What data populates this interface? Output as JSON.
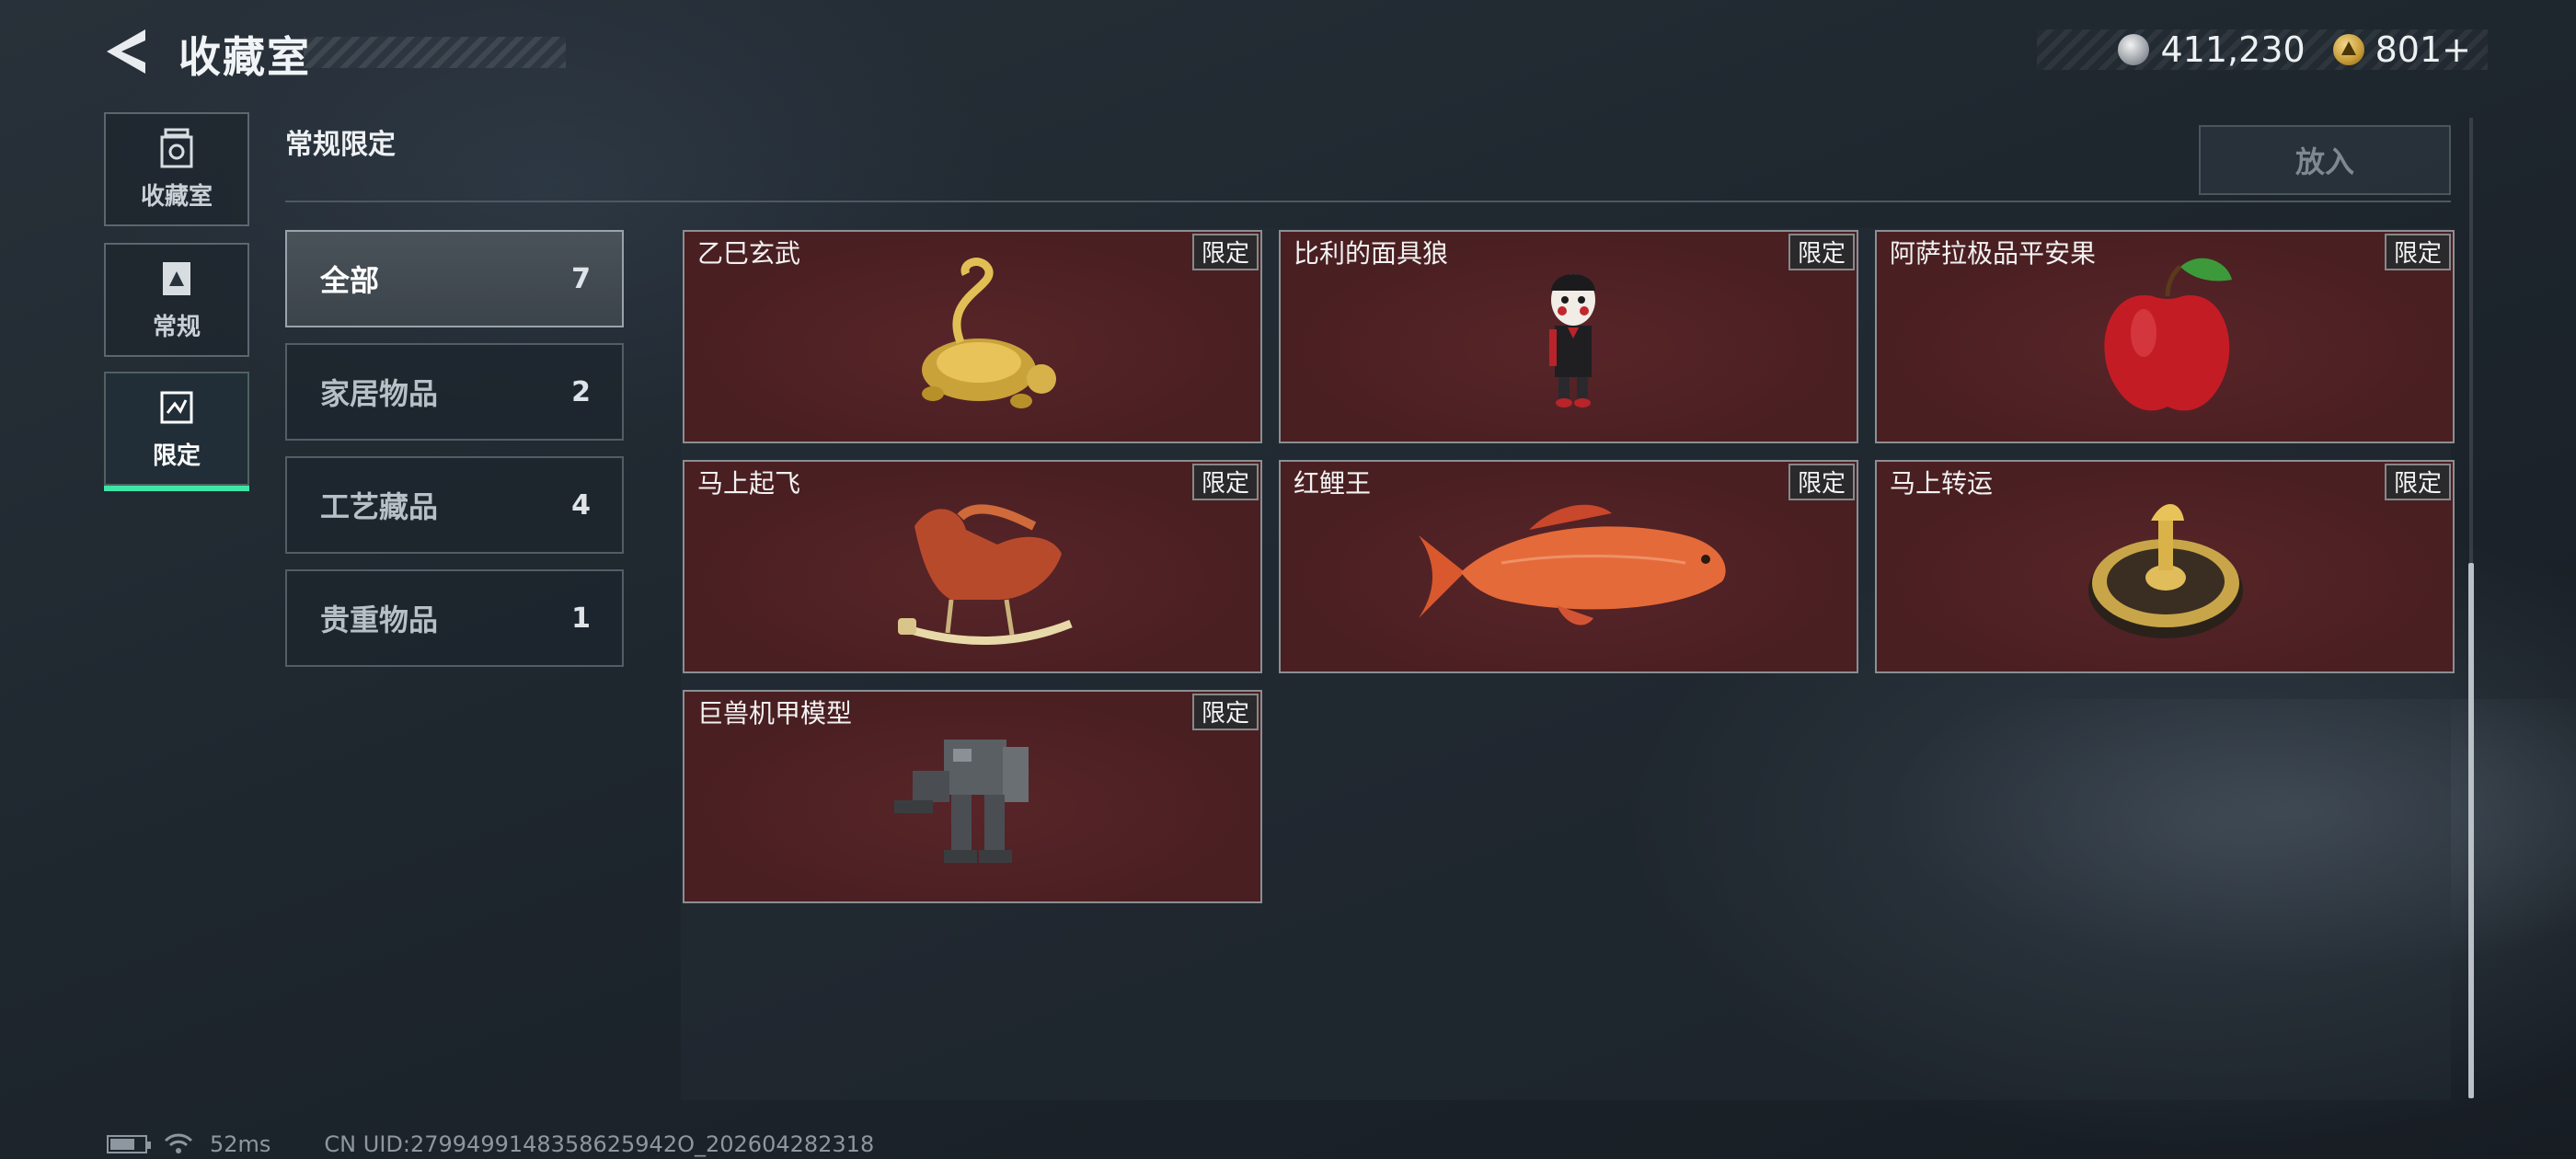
{
  "header": {
    "title": "收藏室",
    "currencies": [
      {
        "icon": "silver-coin-icon",
        "value": "411,230"
      },
      {
        "icon": "gold-triangle-coin-icon",
        "value": "801+"
      }
    ]
  },
  "rail": [
    {
      "label": "收藏室",
      "icon": "collection-room-icon",
      "active": false
    },
    {
      "label": "常规",
      "icon": "regular-icon",
      "active": false
    },
    {
      "label": "限定",
      "icon": "limited-icon",
      "active": true
    }
  ],
  "section": {
    "title": "常规限定",
    "put_button": "放入"
  },
  "categories": [
    {
      "name": "全部",
      "count": "7",
      "active": true
    },
    {
      "name": "家居物品",
      "count": "2",
      "active": false
    },
    {
      "name": "工艺藏品",
      "count": "4",
      "active": false
    },
    {
      "name": "贵重物品",
      "count": "1",
      "active": false
    }
  ],
  "items": [
    {
      "name": "乙巳玄武",
      "badge": "限定",
      "art": "golden-turtle-snake"
    },
    {
      "name": "比利的面具狼",
      "badge": "限定",
      "art": "puppet-figure"
    },
    {
      "name": "阿萨拉极品平安果",
      "badge": "限定",
      "art": "red-apple"
    },
    {
      "name": "马上起飞",
      "badge": "限定",
      "art": "rocking-horse"
    },
    {
      "name": "红鲤王",
      "badge": "限定",
      "art": "red-carp"
    },
    {
      "name": "马上转运",
      "badge": "限定",
      "art": "fortune-wheel"
    },
    {
      "name": "巨兽机甲模型",
      "badge": "限定",
      "art": "mech-model"
    }
  ],
  "status": {
    "ping": "52ms",
    "uid": "CN UID:2799499148358625942O_202604282318"
  },
  "colors": {
    "accent": "#3ee6a6",
    "card_bg": "#4a1f22"
  }
}
